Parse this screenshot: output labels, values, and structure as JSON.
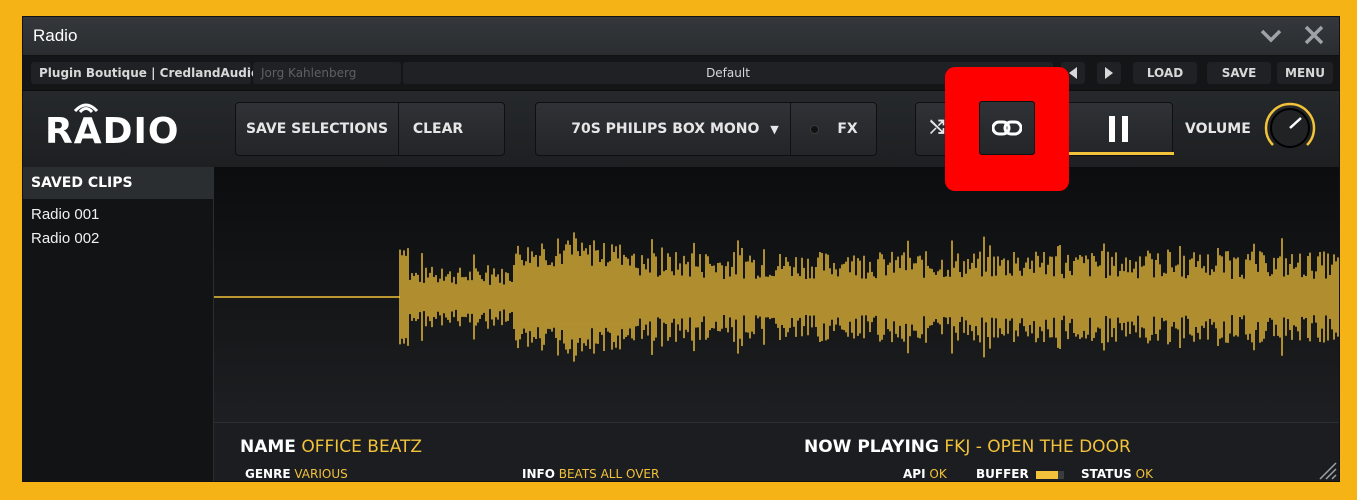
{
  "window": {
    "title": "Radio",
    "minimize_icon": "chevron-down-icon",
    "close_icon": "close-icon"
  },
  "host": {
    "vendor": "Plugin Boutique | CredlandAudio",
    "author": "Jorg Kahlenberg",
    "preset": "Default",
    "load_label": "LOAD",
    "save_label": "SAVE",
    "menu_label": "MENU"
  },
  "plugin": {
    "logo": "RADIO",
    "save_selections_label": "SAVE SELECTIONS",
    "clear_label": "CLEAR",
    "station_preset": "70S PHILIPS BOX MONO",
    "fx_label": "FX",
    "volume_label": "VOLUME",
    "playback_state": "playing"
  },
  "sidebar": {
    "header": "SAVED CLIPS",
    "items": [
      "Radio 001",
      "Radio 002"
    ]
  },
  "info": {
    "name_label": "NAME",
    "name_value": "OFFICE BEATZ",
    "now_playing_label": "NOW PLAYING",
    "now_playing_value": "FKJ - OPEN THE DOOR",
    "genre_label": "GENRE",
    "genre_value": "VARIOUS",
    "info_label": "INFO",
    "info_value": "BEATS ALL OVER",
    "api_label": "API",
    "api_value": "OK",
    "buffer_label": "BUFFER",
    "status_label": "STATUS",
    "status_value": "OK"
  },
  "colors": {
    "accent": "#f2c23a",
    "highlight": "#ff0000",
    "background": "#f5b316"
  }
}
